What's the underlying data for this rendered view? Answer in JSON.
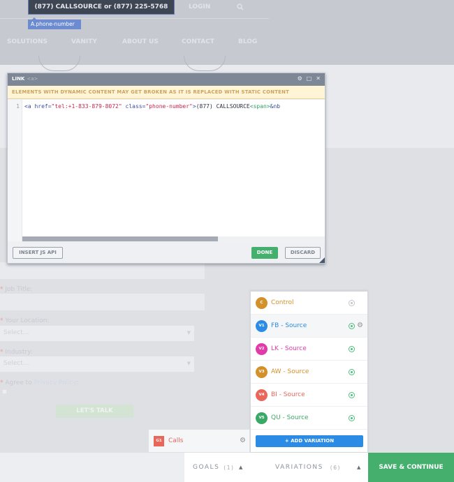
{
  "header": {
    "phone": "(877) CALLSOURCE  or  (877) 225-5768",
    "login": "LOGIN",
    "element_tag": "A.phone-number",
    "nav": [
      "SOLUTIONS",
      "VANITY",
      "ABOUT US",
      "CONTACT",
      "BLOG"
    ]
  },
  "form": {
    "job_title_label": "Job Title:",
    "location_label": "Your Location:",
    "location_value": "Select...",
    "industry_label": "Industry:",
    "industry_value": "Select...",
    "agree_label": "Agree to",
    "agree_link": "Privacy Policy",
    "submit": "LET'S TALK",
    "required_mark": "*"
  },
  "modal": {
    "title": "LINK",
    "subtitle": "<a>",
    "warning": "ELEMENTS WITH DYNAMIC CONTENT MAY GET BROKEN AS IT IS REPLACED WITH STATIC CONTENT",
    "line_number": "1",
    "code": {
      "open": "<a ",
      "href_attr": "href=",
      "href_val": "\"tel:+1-833-879-8072\"",
      "class_attr": " class=",
      "class_val": "\"phone-number\"",
      "close": ">",
      "text": "(877) CALLSOURCE",
      "span": "<span>",
      "entity": "&nb"
    },
    "insert_js_api": "INSERT JS API",
    "done": "DONE",
    "discard": "DISCARD"
  },
  "variations": {
    "items": [
      {
        "badge": "C",
        "name": "Control",
        "color": "#d4902a",
        "status": "inactive"
      },
      {
        "badge": "V1",
        "name": "FB - Source",
        "color": "#2b8be5",
        "status": "active"
      },
      {
        "badge": "V2",
        "name": "LK - Source",
        "color": "#e23aa8",
        "status": "active"
      },
      {
        "badge": "V3",
        "name": "AW - Source",
        "color": "#d4902a",
        "status": "active"
      },
      {
        "badge": "V4",
        "name": "BI - Source",
        "color": "#e9675a",
        "status": "active"
      },
      {
        "badge": "V5",
        "name": "QU - Source",
        "color": "#3aa866",
        "status": "active"
      }
    ],
    "add_label": "+ ADD VARIATION"
  },
  "goals": {
    "items": [
      {
        "badge": "G1",
        "name": "Calls"
      }
    ]
  },
  "bottom": {
    "goals_label": "GOALS",
    "goals_count": "(1)",
    "variations_label": "VARIATIONS",
    "variations_count": "(6)",
    "save": "SAVE & CONTINUE"
  }
}
